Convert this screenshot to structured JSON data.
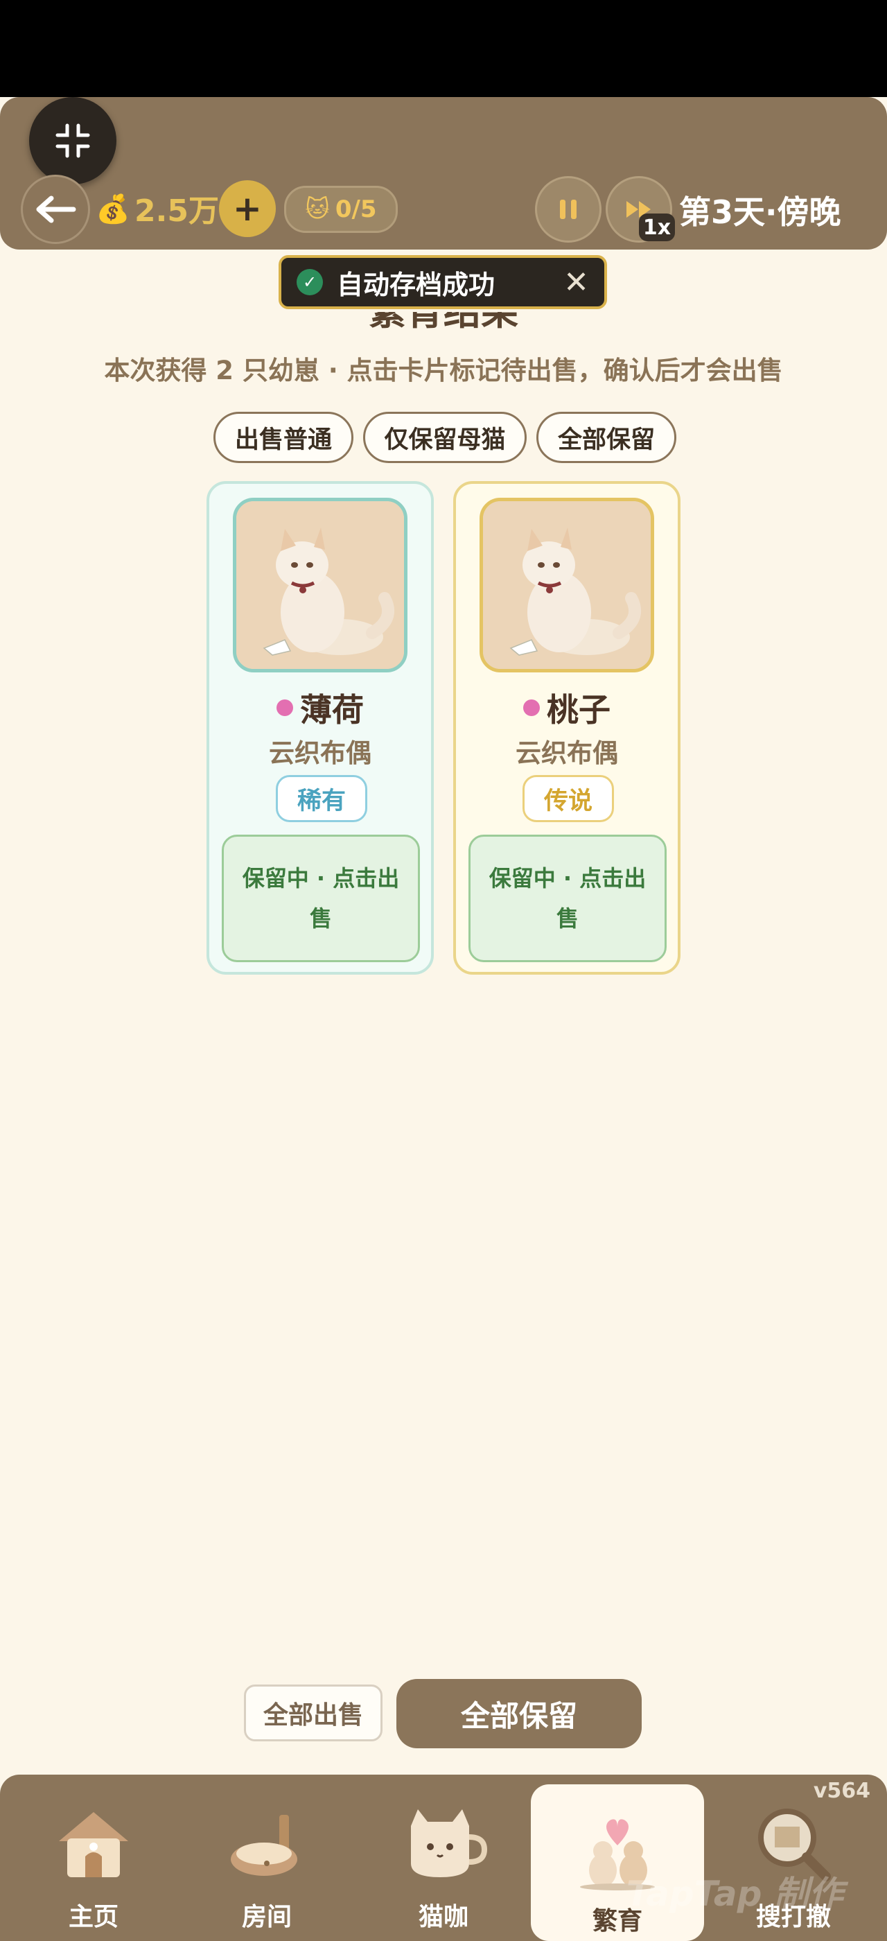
{
  "header": {
    "money": "2.5万",
    "plus_label": "+",
    "cat_count": "0/5",
    "speed": "1x",
    "day": "第3天·傍晚"
  },
  "toast": {
    "message": "自动存档成功"
  },
  "breeding": {
    "title": "繁育结果",
    "subtitle": "本次获得 2 只幼崽 · 点击卡片标记待出售，确认后才会出售",
    "filters": [
      "出售普通",
      "仅保留母猫",
      "全部保留"
    ],
    "cards": [
      {
        "name": "薄荷",
        "breed": "云织布偶",
        "rarity": "稀有",
        "status": "保留中 · 点击出售"
      },
      {
        "name": "桃子",
        "breed": "云织布偶",
        "rarity": "传说",
        "status": "保留中 · 点击出售"
      }
    ],
    "sell_all": "全部出售",
    "keep_all": "全部保留"
  },
  "nav": {
    "items": [
      {
        "label": "主页",
        "icon": "house-icon"
      },
      {
        "label": "房间",
        "icon": "cat-bed-icon"
      },
      {
        "label": "猫咖",
        "icon": "cat-cup-icon"
      },
      {
        "label": "繁育",
        "icon": "cats-heart-icon"
      },
      {
        "label": "搜打撤",
        "icon": "magnifier-map-icon"
      }
    ],
    "active_index": 3
  },
  "version": "v564",
  "watermark": "TapTap 制作",
  "colors": {
    "header_bg": "#8b755a",
    "accent_gold": "#d8b148",
    "page_bg": "#fcf6e9",
    "rare": "#4aa3bf",
    "legend": "#d4a630"
  }
}
